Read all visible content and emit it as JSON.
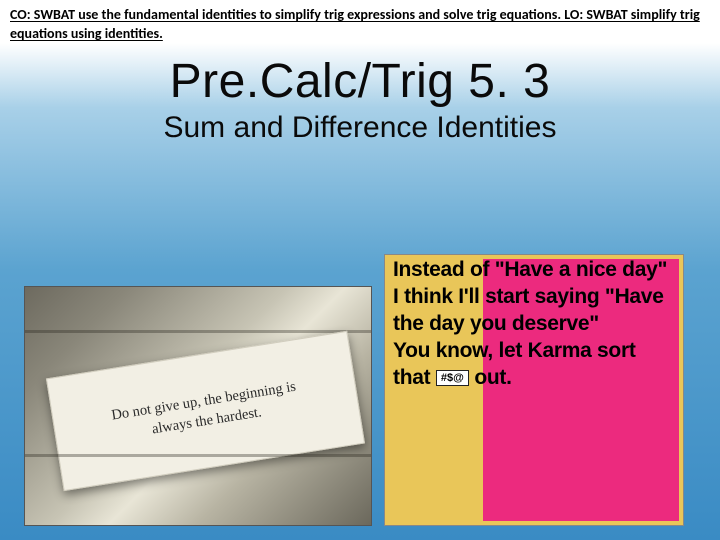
{
  "objectives": "CO: SWBAT use the fundamental identities to simplify  trig expressions and solve trig equations.  LO: SWBAT simplify trig equations using identities.",
  "title": "Pre.Calc/Trig 5. 3",
  "subtitle": "Sum and Difference Identities",
  "leftImage": {
    "line1": "Do not give up, the beginning is",
    "line2": "always the hardest."
  },
  "rightImage": {
    "text_pre": "Instead of \"Have a nice day\" I think I'll start saying \"Have the day you deserve\"\nYou know, let Karma sort that",
    "censor": "#$@",
    "text_post": " out."
  }
}
